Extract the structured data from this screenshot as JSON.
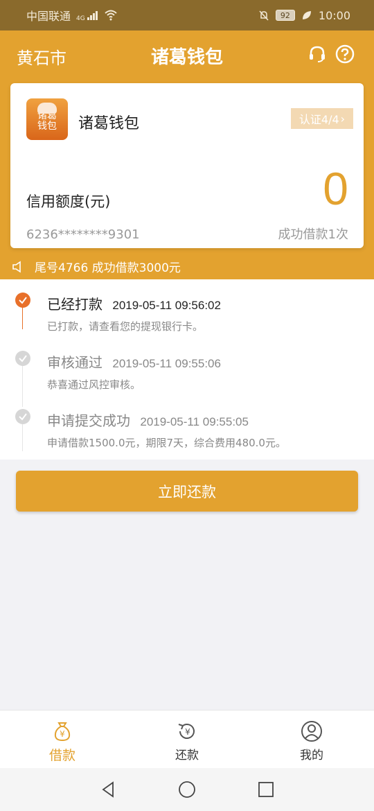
{
  "status_bar": {
    "carrier": "中国联通",
    "network": "4G",
    "battery": "92",
    "time": "10:00"
  },
  "header": {
    "city": "黄石市",
    "title": "诸葛钱包",
    "icons": [
      "headset-icon",
      "help-icon"
    ]
  },
  "card": {
    "logo_text_line1": "诸葛",
    "logo_text_line2": "钱包",
    "name": "诸葛钱包",
    "cert_badge": "认证4/4",
    "limit_label": "信用额度(元)",
    "limit_value": "0",
    "card_number": "6236********9301",
    "success_count": "成功借款1次"
  },
  "notice": {
    "text": "尾号4766 成功借款3000元"
  },
  "timeline": [
    {
      "name": "已经打款",
      "time": "2019-05-11 09:56:02",
      "desc": "已打款，请查看您的提现银行卡。",
      "active": true
    },
    {
      "name": "审核通过",
      "time": "2019-05-11 09:55:06",
      "desc": "恭喜通过风控审核。",
      "active": false
    },
    {
      "name": "申请提交成功",
      "time": "2019-05-11 09:55:05",
      "desc": "申请借款1500.0元，期限7天，综合费用480.0元。",
      "active": false
    }
  ],
  "repay_button": "立即还款",
  "tabs": [
    {
      "label": "借款",
      "icon": "money-bag-icon",
      "active": true
    },
    {
      "label": "还款",
      "icon": "repay-cycle-icon",
      "active": false
    },
    {
      "label": "我的",
      "icon": "user-icon",
      "active": false
    }
  ],
  "colors": {
    "brand": "#e3a22f",
    "active_step": "#e8702a",
    "status_bar": "#8a6a2c"
  }
}
